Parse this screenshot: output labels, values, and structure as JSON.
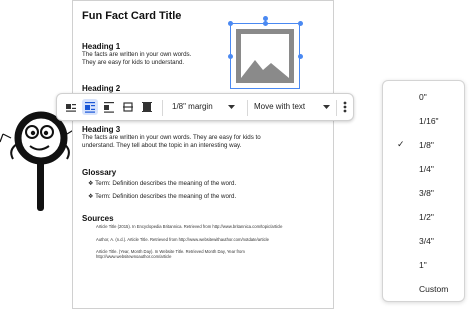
{
  "document": {
    "title": "Fun Fact Card Title",
    "sections": [
      {
        "heading": "Heading 1",
        "lines": [
          "The facts are written in your own words.",
          "They are easy for kids to understand."
        ]
      },
      {
        "heading": "Heading 2",
        "lines": []
      },
      {
        "heading": "Heading 3",
        "lines": [
          "The facts are written in your own words. They are easy for kids to",
          "understand. They tell about the topic in an interesting way."
        ]
      }
    ],
    "glossary": {
      "heading": "Glossary",
      "items": [
        "Term: Definition describes the meaning of the word.",
        "Term: Definition describes the meaning of the word."
      ]
    },
    "sources": {
      "heading": "Sources",
      "items": [
        "Article Title (2015). In Encyclopedia Britannica. Retrieved from http://www.britannica.com/topic/article",
        "Author, A. (n.d.). Article Title. Retrieved from http://www.websitewithauthor.com/notdate/article",
        "Article Title. (Year, Month Day). In Website Title. Retrieved Month Day, Year from",
        "http://www.websitewnoauthor.com/article"
      ]
    }
  },
  "toolbar": {
    "margin_label": "1/8\" margin",
    "wrap_label": "Move with text",
    "more_icon": "more-vert-icon"
  },
  "margin_menu": {
    "selected": "1/8\"",
    "options": [
      "0\"",
      "1/16\"",
      "1/8\"",
      "1/4\"",
      "3/8\"",
      "1/2\"",
      "3/4\"",
      "1\"",
      "Custom"
    ]
  },
  "colors": {
    "accent": "#4a89f2",
    "active_bg": "#d7e3fc"
  }
}
